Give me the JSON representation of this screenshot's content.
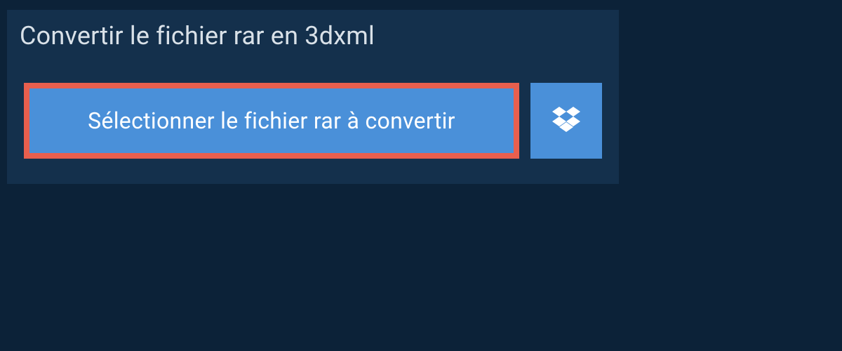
{
  "header": {
    "title": "Convertir le fichier rar en 3dxml"
  },
  "actions": {
    "select_file_label": "Sélectionner le fichier rar à convertir",
    "cloud_provider": "dropbox"
  },
  "colors": {
    "page_bg": "#0c2238",
    "panel_bg": "#14304c",
    "button_bg": "#4a90d9",
    "highlight_border": "#e85f4e",
    "title_text": "#d9e1e8",
    "button_text": "#ffffff"
  }
}
